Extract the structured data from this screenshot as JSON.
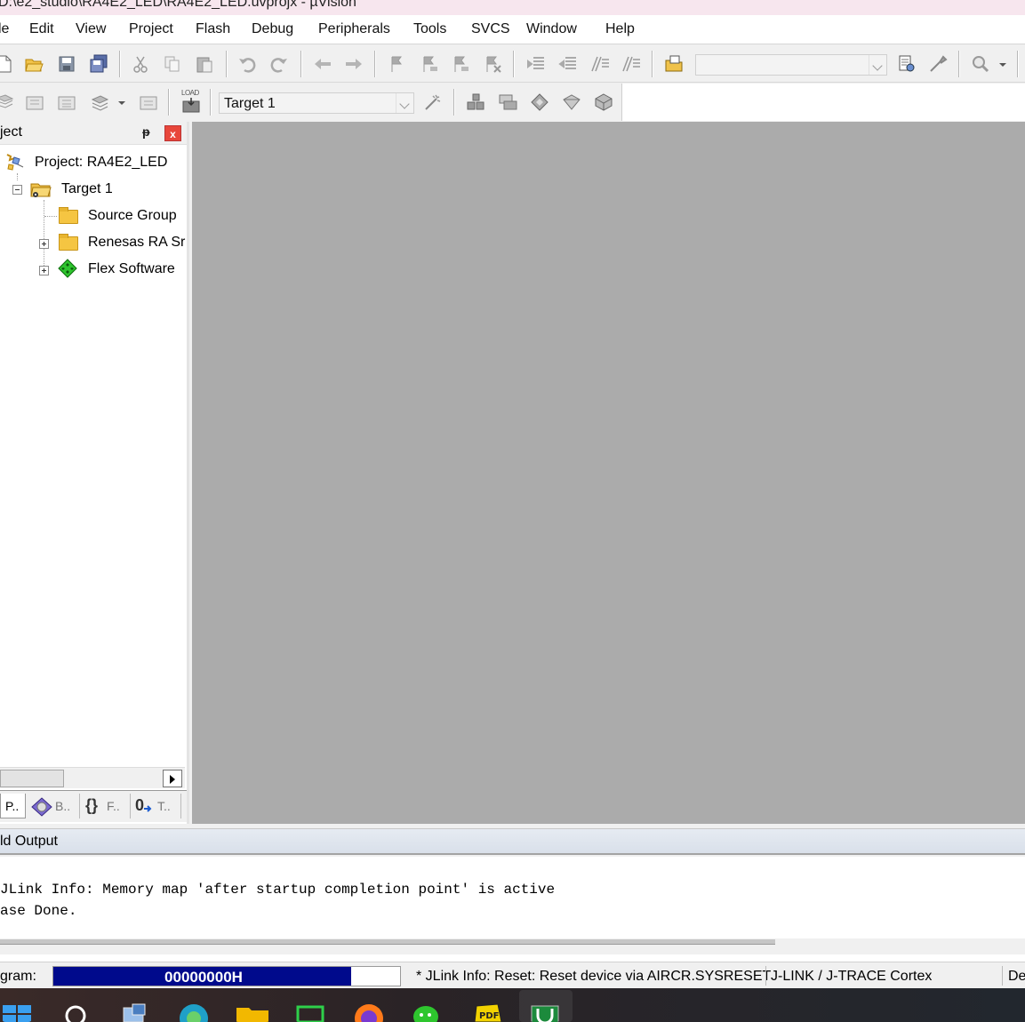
{
  "window": {
    "title": "D:\\e2_studio\\RA4E2_LED\\RA4E2_LED.uvprojx - µVision"
  },
  "menu": {
    "items": [
      "le",
      "Edit",
      "View",
      "Project",
      "Flash",
      "Debug",
      "Peripherals",
      "Tools",
      "SVCS",
      "Window",
      "Help"
    ]
  },
  "toolbar": {
    "target_select": "Target 1",
    "find_combo_value": "",
    "load_label": "LOAD"
  },
  "project_panel": {
    "title": "ject",
    "pin_glyph": "ᵽ",
    "close_glyph": "x",
    "tree": {
      "project": "Project: RA4E2_LED",
      "target": "Target 1",
      "children": [
        "Source Group",
        "Renesas RA Sr",
        "Flex Software"
      ]
    },
    "tabs": [
      "P..",
      "B..",
      "F..",
      "T.."
    ],
    "tab_icons": [
      "{}",
      "0"
    ]
  },
  "build_output": {
    "title": "ld Output",
    "lines": [
      "JLink Info: Memory map 'after startup completion point' is active",
      "ase Done."
    ]
  },
  "status_bar": {
    "label": "gram:",
    "progress_text": "00000000H",
    "progress_fraction": 0.86,
    "message": "* JLink Info: Reset: Reset device via AIRCR.SYSRESET",
    "debugger": "J-LINK / J-TRACE Cortex",
    "right_text": "De"
  },
  "colors": {
    "progress_fill": "#000a8c",
    "editor_bg": "#ababab",
    "close_button": "#e8473b"
  }
}
